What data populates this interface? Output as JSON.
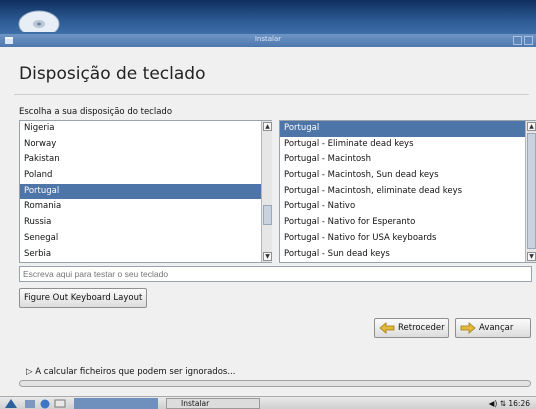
{
  "window": {
    "title": "Instalar"
  },
  "page": {
    "heading": "Disposição de teclado",
    "choose_label": "Escolha a sua disposição do teclado"
  },
  "countries": {
    "items": [
      "Nigeria",
      "Norway",
      "Pakistan",
      "Poland",
      "Portugal",
      "Romania",
      "Russia",
      "Senegal",
      "Serbia"
    ],
    "selected": "Portugal"
  },
  "variants": {
    "items": [
      "Portugal",
      "Portugal - Eliminate dead keys",
      "Portugal - Macintosh",
      "Portugal - Macintosh, Sun dead keys",
      "Portugal - Macintosh, eliminate dead keys",
      "Portugal - Nativo",
      "Portugal - Nativo for Esperanto",
      "Portugal - Nativo for USA keyboards",
      "Portugal - Sun dead keys"
    ],
    "selected": "Portugal"
  },
  "test_field": {
    "placeholder": "Escreva aqui para testar o seu teclado"
  },
  "buttons": {
    "figure_out": "Figure Out Keyboard Layout",
    "back": "Retroceder",
    "forward": "Avançar"
  },
  "progress": {
    "label": "A calcular ficheiros que podem ser ignorados...",
    "value": 0
  },
  "taskbar": {
    "task_label": "Instalar",
    "clock": "16:26"
  },
  "colors": {
    "selection": "#4d75a8",
    "titlebar": "#5a82b8",
    "desktop": "#2c5a93"
  }
}
